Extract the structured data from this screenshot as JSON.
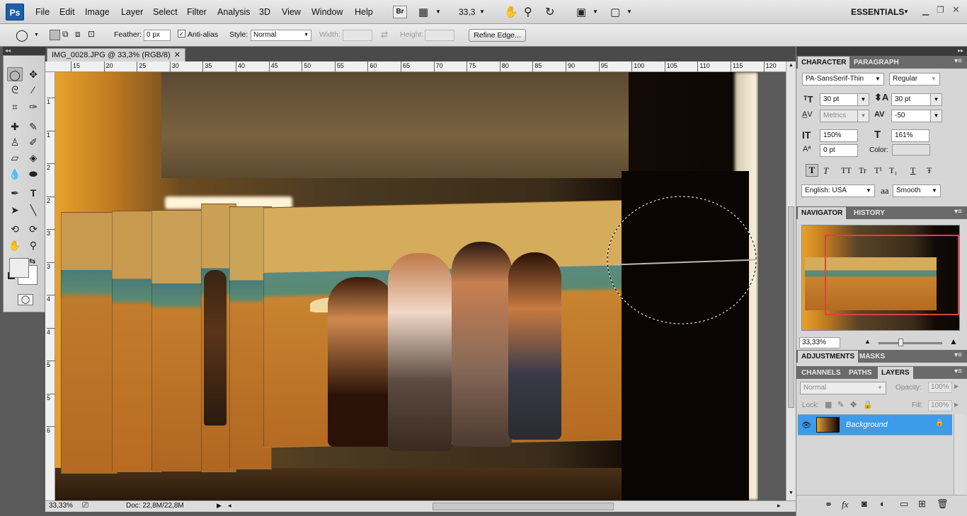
{
  "menubar": {
    "logo": "Ps",
    "items": [
      "File",
      "Edit",
      "Image",
      "Layer",
      "Select",
      "Filter",
      "Analysis",
      "3D",
      "View",
      "Window",
      "Help"
    ],
    "bridge": "Br",
    "zoom": "33,3",
    "workspace": "ESSENTIALS"
  },
  "options": {
    "feather_label": "Feather:",
    "feather_value": "0 px",
    "antialias_label": "Anti-alias",
    "style_label": "Style:",
    "style_value": "Normal",
    "width_label": "Width:",
    "height_label": "Height:",
    "refine_label": "Refine Edge..."
  },
  "document": {
    "tab_title": "IMG_0028.JPG @ 33,3% (RGB/8)",
    "ruler_h": [
      "15",
      "20",
      "25",
      "30",
      "35",
      "40",
      "45",
      "50",
      "55",
      "60",
      "65",
      "70",
      "75",
      "80",
      "85",
      "90",
      "95",
      "100",
      "105",
      "110",
      "115",
      "120"
    ],
    "ruler_v": [
      "1",
      "1",
      "2",
      "2",
      "3",
      "3",
      "4",
      "4",
      "5",
      "5",
      "6"
    ],
    "zoom_status": "33,33%",
    "doc_info": "Doc: 22,8M/22,8M"
  },
  "character": {
    "tab1": "CHARACTER",
    "tab2": "PARAGRAPH",
    "font": "PA-SansSerif-Thin",
    "style": "Regular",
    "size": "30 pt",
    "leading": "30 pt",
    "kerning": "Metrics",
    "tracking": "-50",
    "vscale": "150%",
    "hscale": "161%",
    "baseline": "0 pt",
    "color_label": "Color:",
    "language": "English: USA",
    "aa_label": "aa",
    "antialias": "Smooth",
    "type_buttons": [
      "T",
      "T",
      "TT",
      "Tr",
      "T¹",
      "T₁",
      "T",
      "Ŧ"
    ]
  },
  "navigator": {
    "tab1": "NAVIGATOR",
    "tab2": "HISTORY",
    "zoom": "33,33%"
  },
  "adjustments": {
    "tab1": "ADJUSTMENTS",
    "tab2": "MASKS"
  },
  "layers": {
    "tab1": "CHANNELS",
    "tab2": "PATHS",
    "tab3": "LAYERS",
    "blend": "Normal",
    "opacity_label": "Opacity:",
    "opacity": "100%",
    "lock_label": "Lock:",
    "fill_label": "Fill:",
    "fill": "100%",
    "layer_name": "Background"
  },
  "colors": {
    "accent": "#3a8ee8",
    "layer_sel": "#3d9be9",
    "nav_frame": "#e04040"
  }
}
